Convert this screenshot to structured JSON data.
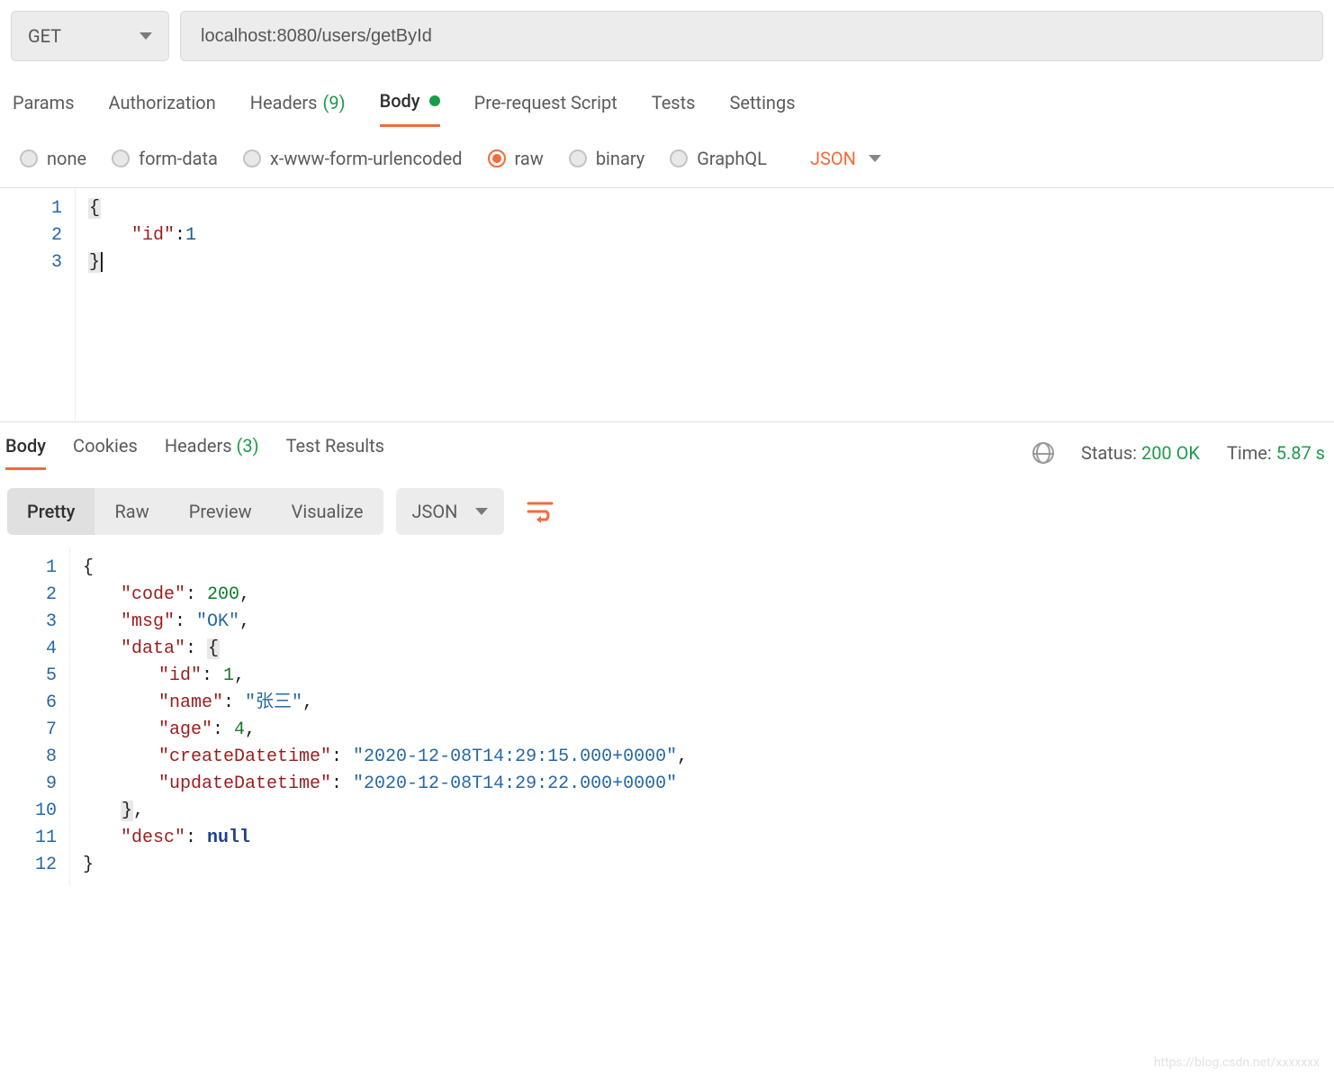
{
  "request": {
    "method": "GET",
    "url": "localhost:8080/users/getById"
  },
  "tabs": {
    "params": "Params",
    "authorization": "Authorization",
    "headers": "Headers",
    "headers_count": "(9)",
    "body": "Body",
    "prerequest": "Pre-request Script",
    "tests": "Tests",
    "settings": "Settings"
  },
  "body_types": {
    "none": "none",
    "formdata": "form-data",
    "urlencoded": "x-www-form-urlencoded",
    "raw": "raw",
    "binary": "binary",
    "graphql": "GraphQL",
    "format": "JSON"
  },
  "request_body": {
    "lines": [
      "1",
      "2",
      "3"
    ],
    "key_id": "\"id\"",
    "val_id": "1",
    "brace_open": "{",
    "brace_close": "}"
  },
  "response_tabs": {
    "body": "Body",
    "cookies": "Cookies",
    "headers": "Headers",
    "headers_count": "(3)",
    "test_results": "Test Results"
  },
  "response_meta": {
    "status_label": "Status:",
    "status_value": "200 OK",
    "time_label": "Time:",
    "time_value": "5.87 s"
  },
  "response_view": {
    "pretty": "Pretty",
    "raw": "Raw",
    "preview": "Preview",
    "visualize": "Visualize",
    "format": "JSON"
  },
  "response_body": {
    "lines": [
      "1",
      "2",
      "3",
      "4",
      "5",
      "6",
      "7",
      "8",
      "9",
      "10",
      "11",
      "12"
    ],
    "keys": {
      "code": "\"code\"",
      "msg": "\"msg\"",
      "data": "\"data\"",
      "id": "\"id\"",
      "name": "\"name\"",
      "age": "\"age\"",
      "create": "\"createDatetime\"",
      "update": "\"updateDatetime\"",
      "desc": "\"desc\""
    },
    "vals": {
      "code": "200",
      "msg": "\"OK\"",
      "id": "1",
      "name": "\"张三\"",
      "age": "4",
      "create": "\"2020-12-08T14:29:15.000+0000\"",
      "update": "\"2020-12-08T14:29:22.000+0000\"",
      "desc": "null"
    },
    "brace_open": "{",
    "brace_close": "}",
    "colon": ":",
    "comma": ","
  },
  "watermark": "https://blog.csdn.net/xxxxxxx"
}
